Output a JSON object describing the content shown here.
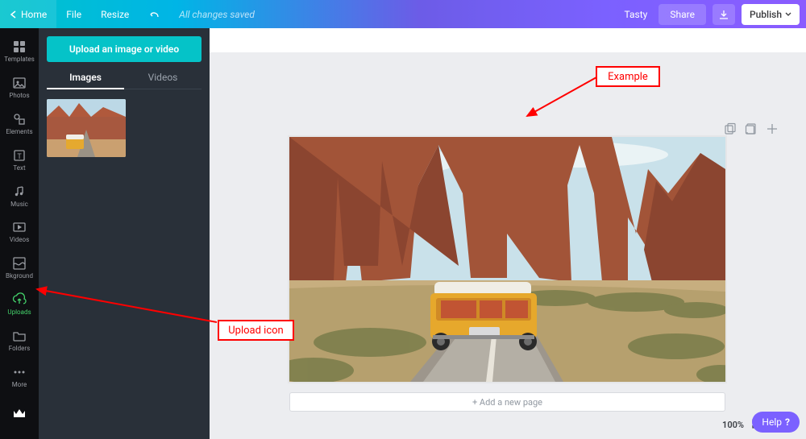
{
  "topbar": {
    "home": "Home",
    "file": "File",
    "resize": "Resize",
    "status": "All changes saved",
    "project_name": "Tasty",
    "share": "Share",
    "publish": "Publish"
  },
  "rail": {
    "templates": "Templates",
    "photos": "Photos",
    "elements": "Elements",
    "text": "Text",
    "music": "Music",
    "videos": "Videos",
    "bkground": "Bkground",
    "uploads": "Uploads",
    "folders": "Folders",
    "more": "More"
  },
  "panel": {
    "upload_button": "Upload an image or video",
    "tab_images": "Images",
    "tab_videos": "Videos"
  },
  "canvas": {
    "add_page": "+ Add a new page",
    "zoom_pct": "100%",
    "help": "Help",
    "help_q": "?"
  },
  "annotations": {
    "example": "Example",
    "upload_icon": "Upload icon"
  }
}
